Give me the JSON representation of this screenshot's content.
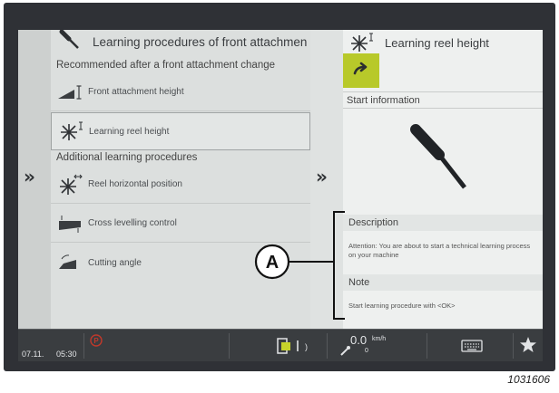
{
  "left": {
    "title": "Learning procedures of front attachmen",
    "section_recommended": "Recommended after a front attachment change",
    "recommended_items": [
      {
        "label": "Front attachment height",
        "icon": "header-height-icon"
      },
      {
        "label": "Learning reel height",
        "icon": "reel-height-icon",
        "selected": true
      }
    ],
    "section_additional": "Additional learning procedures",
    "additional_items": [
      {
        "label": "Reel horizontal position",
        "icon": "reel-horizontal-icon"
      },
      {
        "label": "Cross levelling control",
        "icon": "cross-level-icon"
      },
      {
        "label": "Cutting angle",
        "icon": "cutting-angle-icon"
      }
    ],
    "chevron": "»"
  },
  "right": {
    "title": "Learning reel height",
    "go_button_icon": "arrow-right-icon",
    "start_info_label": "Start information",
    "description_label": "Description",
    "description_text": "Attention: You are about to start a technical learning process on your machine",
    "note_label": "Note",
    "note_text": "Start learning procedure with <OK>",
    "chevron": "»"
  },
  "status_bar": {
    "date": "07.11.",
    "time": "05:30",
    "speed": "0.0",
    "speed_unit": "km/h",
    "sub_value": "0"
  },
  "callout_label": "A",
  "figure_number": "1031606",
  "colors": {
    "accent_green": "#b8c92a",
    "status_bg": "#3a3d40",
    "parking_red": "#c0392b"
  }
}
